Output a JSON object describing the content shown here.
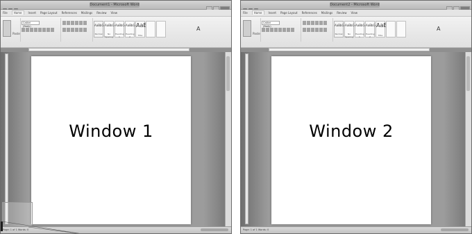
{
  "windows": [
    {
      "label": "Window 1",
      "title": "Document1 - Microsoft Word",
      "tabs": [
        "File",
        "Home",
        "Insert",
        "Page Layout",
        "References",
        "Mailings",
        "Review",
        "View"
      ],
      "active_tab": "Home",
      "clipboard": {
        "paste_label": "Paste"
      },
      "font": {
        "name": "Calibri (Body)"
      },
      "styles": [
        "Normal",
        "No Spacing",
        "Heading 1",
        "Heading 2",
        "Title"
      ],
      "status_text": "Page: 1 of 1   Words: 0"
    },
    {
      "label": "Window 2",
      "title": "Document2 - Microsoft Word",
      "tabs": [
        "File",
        "Home",
        "Insert",
        "Page Layout",
        "References",
        "Mailings",
        "Review",
        "View"
      ],
      "active_tab": "Home",
      "clipboard": {
        "paste_label": "Paste"
      },
      "font": {
        "name": "Calibri (Body)"
      },
      "styles": [
        "Normal",
        "No Spacing",
        "Heading 1",
        "Heading 2",
        "Title"
      ],
      "status_text": "Page: 1 of 1   Words: 0"
    }
  ]
}
